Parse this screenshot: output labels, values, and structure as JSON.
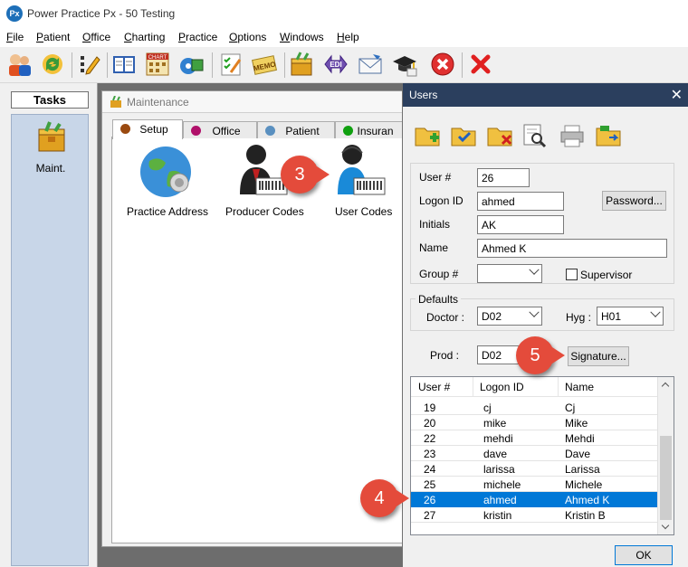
{
  "window": {
    "title": "Power Practice Px - 50 Testing",
    "app_icon_text": "Px"
  },
  "menu": [
    {
      "name": "file",
      "label": "File",
      "u": "F",
      "rest": "ile"
    },
    {
      "name": "patient",
      "label": "Patient",
      "u": "P",
      "rest": "atient"
    },
    {
      "name": "office",
      "label": "Office",
      "u": "O",
      "rest": "ffice"
    },
    {
      "name": "charting",
      "label": "Charting",
      "u": "C",
      "rest": "harting"
    },
    {
      "name": "practice",
      "label": "Practice",
      "u": "P",
      "rest": "ractice"
    },
    {
      "name": "options",
      "label": "Options",
      "u": "O",
      "rest": "ptions"
    },
    {
      "name": "windows",
      "label": "Windows",
      "u": "W",
      "rest": "indows"
    },
    {
      "name": "help",
      "label": "Help",
      "u": "H",
      "rest": "elp"
    }
  ],
  "toolbar": {
    "chart_icon_text": "CHART",
    "memo_icon_text": "MEMO",
    "edi_icon_text": "EDI"
  },
  "tasks": {
    "title": "Tasks",
    "items": [
      {
        "label": "Maint."
      }
    ]
  },
  "maintenance": {
    "title": "Maintenance",
    "tabs": [
      {
        "label": "Setup",
        "color": "#9a4a10"
      },
      {
        "label": "Office",
        "color": "#b0106a"
      },
      {
        "label": "Patient",
        "color": "#5a90c0"
      },
      {
        "label": "Insuran",
        "color": "#10a010"
      }
    ],
    "icons": [
      {
        "label": "Practice Address"
      },
      {
        "label": "Producer Codes"
      },
      {
        "label": "User Codes"
      }
    ]
  },
  "callouts": [
    "3",
    "4",
    "5"
  ],
  "users_dialog": {
    "title": "Users",
    "fields": {
      "user_num_label": "User #",
      "user_num": "26",
      "logon_label": "Logon ID",
      "logon": "ahmed",
      "initials_label": "Initials",
      "initials": "AK",
      "name_label": "Name",
      "name": "Ahmed K",
      "group_label": "Group #",
      "group": "",
      "supervisor_label": "Supervisor"
    },
    "password_button": "Password...",
    "defaults": {
      "legend": "Defaults",
      "doctor_label": "Doctor :",
      "doctor": "D02",
      "hyg_label": "Hyg :",
      "hyg": "H01"
    },
    "prod_label": "Prod :",
    "prod": "D02",
    "signature_button": "Signature...",
    "list": {
      "columns": [
        "User #",
        "Logon ID",
        "Name"
      ],
      "rows": [
        {
          "num": "19",
          "logon": "cj",
          "name": "Cj"
        },
        {
          "num": "20",
          "logon": "mike",
          "name": "Mike"
        },
        {
          "num": "22",
          "logon": "mehdi",
          "name": "Mehdi"
        },
        {
          "num": "23",
          "logon": "dave",
          "name": "Dave"
        },
        {
          "num": "24",
          "logon": "larissa",
          "name": "Larissa"
        },
        {
          "num": "25",
          "logon": "michele",
          "name": "Michele"
        },
        {
          "num": "26",
          "logon": "ahmed",
          "name": "Ahmed K"
        },
        {
          "num": "27",
          "logon": "kristin",
          "name": "Kristin B"
        }
      ],
      "selected_index": 6
    },
    "ok_button": "OK"
  },
  "colors": {
    "accent": "#0078d7",
    "callout": "#e44b3b",
    "dialog_title": "#2b3f5e"
  }
}
